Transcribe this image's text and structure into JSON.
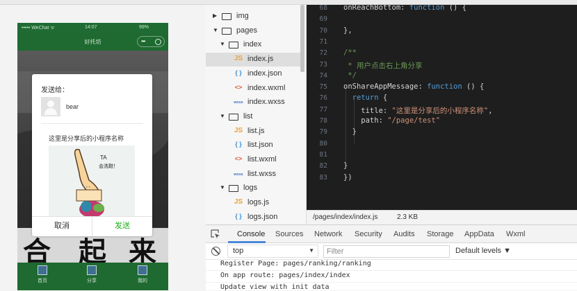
{
  "simulator": {
    "status_left": "••••• WeChat ᯤ",
    "status_time": "14:07",
    "status_battery": "99%",
    "nav_title": "好托坊",
    "calligraphy": [
      "合",
      "起",
      "来"
    ],
    "tabs": [
      {
        "label": "首页"
      },
      {
        "label": "分享"
      },
      {
        "label": "我的"
      }
    ],
    "share_dialog": {
      "send_to_label": "发送给：",
      "friend_name": "bear",
      "share_title": "这里是分享后的小程序名称",
      "sticker_text_1": "TA",
      "sticker_text_2": "会洗鞋！",
      "cancel_label": "取消",
      "send_label": "发送",
      "send_color": "#1aad19"
    }
  },
  "file_tree": {
    "items": [
      {
        "type": "folder",
        "name": "img",
        "expanded": false,
        "depth": 0
      },
      {
        "type": "folder",
        "name": "pages",
        "expanded": true,
        "depth": 0
      },
      {
        "type": "folder",
        "name": "index",
        "expanded": true,
        "depth": 1
      },
      {
        "type": "file",
        "kind": "js",
        "icon": "JS",
        "name": "index.js",
        "depth": 2,
        "selected": true
      },
      {
        "type": "file",
        "kind": "json",
        "icon": "{ }",
        "name": "index.json",
        "depth": 2
      },
      {
        "type": "file",
        "kind": "wxml",
        "icon": "<>",
        "name": "index.wxml",
        "depth": 2
      },
      {
        "type": "file",
        "kind": "wxss",
        "icon": "wxss",
        "name": "index.wxss",
        "depth": 2
      },
      {
        "type": "folder",
        "name": "list",
        "expanded": true,
        "depth": 1
      },
      {
        "type": "file",
        "kind": "js",
        "icon": "JS",
        "name": "list.js",
        "depth": 2
      },
      {
        "type": "file",
        "kind": "json",
        "icon": "{ }",
        "name": "list.json",
        "depth": 2
      },
      {
        "type": "file",
        "kind": "wxml",
        "icon": "<>",
        "name": "list.wxml",
        "depth": 2
      },
      {
        "type": "file",
        "kind": "wxss",
        "icon": "wxss",
        "name": "list.wxss",
        "depth": 2
      },
      {
        "type": "folder",
        "name": "logs",
        "expanded": true,
        "depth": 1
      },
      {
        "type": "file",
        "kind": "js",
        "icon": "JS",
        "name": "logs.js",
        "depth": 2
      },
      {
        "type": "file",
        "kind": "json",
        "icon": "{ }",
        "name": "logs.json",
        "depth": 2
      }
    ]
  },
  "editor": {
    "lines": [
      {
        "num": "68",
        "tokens": [
          {
            "t": "plain",
            "v": "onReachBottom: "
          },
          {
            "t": "kw",
            "v": "function"
          },
          {
            "t": "plain",
            "v": " () {"
          }
        ]
      },
      {
        "num": "69",
        "tokens": []
      },
      {
        "num": "70",
        "tokens": [
          {
            "t": "plain",
            "v": "},"
          }
        ]
      },
      {
        "num": "71",
        "tokens": []
      },
      {
        "num": "72",
        "tokens": [
          {
            "t": "cmt",
            "v": "/**"
          }
        ]
      },
      {
        "num": "73",
        "tokens": [
          {
            "t": "cmt",
            "v": " * 用户点击右上角分享"
          }
        ]
      },
      {
        "num": "74",
        "tokens": [
          {
            "t": "cmt",
            "v": " */"
          }
        ]
      },
      {
        "num": "75",
        "tokens": [
          {
            "t": "plain",
            "v": "onShareAppMessage: "
          },
          {
            "t": "kw",
            "v": "function"
          },
          {
            "t": "plain",
            "v": " () {"
          }
        ]
      },
      {
        "num": "76",
        "tokens": [
          {
            "t": "kw",
            "v": "  return"
          },
          {
            "t": "plain",
            "v": " {"
          }
        ]
      },
      {
        "num": "77",
        "tokens": [
          {
            "t": "plain",
            "v": "    title: "
          },
          {
            "t": "str",
            "v": "\"这里是分享后的小程序名称\""
          },
          {
            "t": "plain",
            "v": ","
          }
        ]
      },
      {
        "num": "78",
        "tokens": [
          {
            "t": "plain",
            "v": "    path: "
          },
          {
            "t": "str",
            "v": "\"/page/test\""
          }
        ]
      },
      {
        "num": "79",
        "tokens": [
          {
            "t": "plain",
            "v": "  }"
          }
        ]
      },
      {
        "num": "80",
        "tokens": []
      },
      {
        "num": "81",
        "tokens": []
      },
      {
        "num": "82",
        "tokens": [
          {
            "t": "plain",
            "v": "}"
          }
        ]
      },
      {
        "num": "83",
        "tokens": [
          {
            "t": "plain",
            "v": "})"
          }
        ]
      }
    ],
    "status_path": "/pages/index/index.js",
    "status_size": "2.3 KB"
  },
  "devtools": {
    "tabs": [
      "Console",
      "Sources",
      "Network",
      "Security",
      "Audits",
      "Storage",
      "AppData",
      "Wxml"
    ],
    "active_tab": "Console",
    "context_value": "top",
    "filter_placeholder": "Filter",
    "levels_label": "Default levels ▼",
    "logs": [
      "Register Page: pages/ranking/ranking",
      "On app route: pages/index/index",
      "Update view with init data"
    ]
  }
}
